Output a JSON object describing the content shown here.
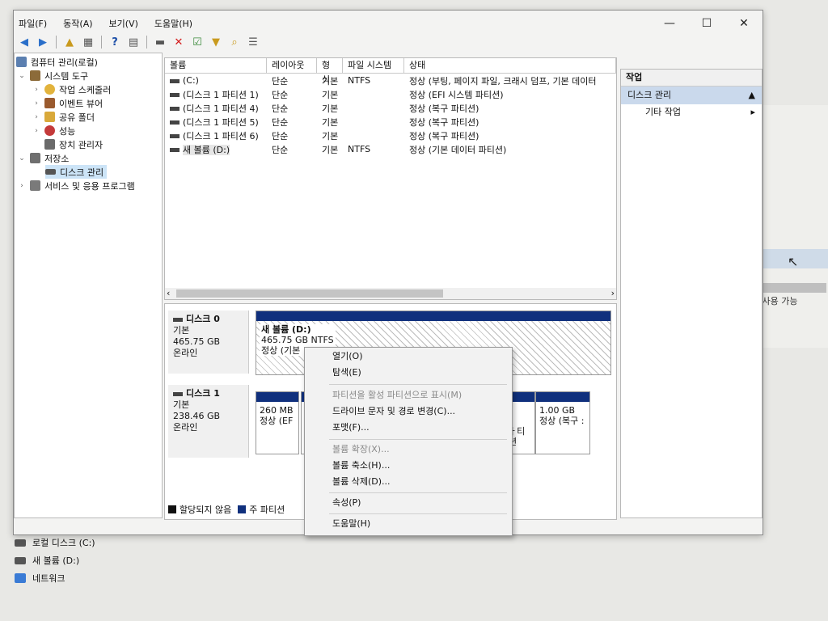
{
  "window": {
    "menus": [
      "파일(F)",
      "동작(A)",
      "보기(V)",
      "도움말(H)"
    ],
    "controls": [
      "—",
      "☐",
      "✕"
    ]
  },
  "tree": {
    "root": "컴퓨터 관리(로컬)",
    "system_tools": "시스템 도구",
    "task_scheduler": "작업 스케줄러",
    "event_viewer": "이벤트 뷰어",
    "shared_folders": "공유 폴더",
    "performance": "성능",
    "device_manager": "장치 관리자",
    "storage": "저장소",
    "disk_management": "디스크 관리",
    "services": "서비스 및 응용 프로그램"
  },
  "volumes": {
    "headers": [
      "볼륨",
      "레이아웃",
      "형식",
      "파일 시스템",
      "상태"
    ],
    "rows": [
      [
        "(C:)",
        "단순",
        "기본",
        "NTFS",
        "정상 (부팅, 페이지 파일, 크래시 덤프, 기본 데이터"
      ],
      [
        "(디스크 1 파티션 1)",
        "단순",
        "기본",
        "",
        "정상 (EFI 시스템 파티션)"
      ],
      [
        "(디스크 1 파티션 4)",
        "단순",
        "기본",
        "",
        "정상 (복구 파티션)"
      ],
      [
        "(디스크 1 파티션 5)",
        "단순",
        "기본",
        "",
        "정상 (복구 파티션)"
      ],
      [
        "(디스크 1 파티션 6)",
        "단순",
        "기본",
        "",
        "정상 (복구 파티션)"
      ],
      [
        "새 볼륨 (D:)",
        "단순",
        "기본",
        "NTFS",
        "정상 (기본 데이터 파티션)"
      ]
    ]
  },
  "disks": {
    "disk0": {
      "name": "디스크 0",
      "type": "기본",
      "size": "465.75 GB",
      "status": "온라인"
    },
    "disk0_part": {
      "name": "새 볼륨  (D:)",
      "size": "465.75 GB NTFS",
      "status": "정상 (기본"
    },
    "disk1": {
      "name": "디스크 1",
      "type": "기본",
      "size": "238.46 GB",
      "status": "온라인"
    },
    "disk1_p1": {
      "size": "260 MB",
      "status": "정상 (EF"
    },
    "disk1_p4": {
      "size": "1.00 GB",
      "status": "정상 (복구 :"
    },
    "disk1_partial": "ㅏ티션",
    "legend_unalloc": "할당되지 않음",
    "legend_primary": "주 파티션"
  },
  "actions": {
    "header": "작업",
    "section": "디스크 관리",
    "more": "기타 작업"
  },
  "context_menu": {
    "open": "열기(O)",
    "explore": "탐색(E)",
    "mark_active": "파티션을 활성 파티션으로 표시(M)",
    "change_letter": "드라이브 문자 및 경로 변경(C)...",
    "format": "포맷(F)...",
    "extend": "볼륨 확장(X)...",
    "shrink": "볼륨 축소(H)...",
    "delete": "볼륨 삭제(D)...",
    "properties": "속성(P)",
    "help": "도움말(H)"
  },
  "background": {
    "avail_text": "3 사용 가능",
    "local_disk": "로컬 디스크 (C:)",
    "new_volume": "새 볼륨 (D:)",
    "network": "네트워크"
  },
  "colors": {
    "primary_partition": "#10307d",
    "unallocated": "#111111",
    "selection": "#cce4f7"
  }
}
